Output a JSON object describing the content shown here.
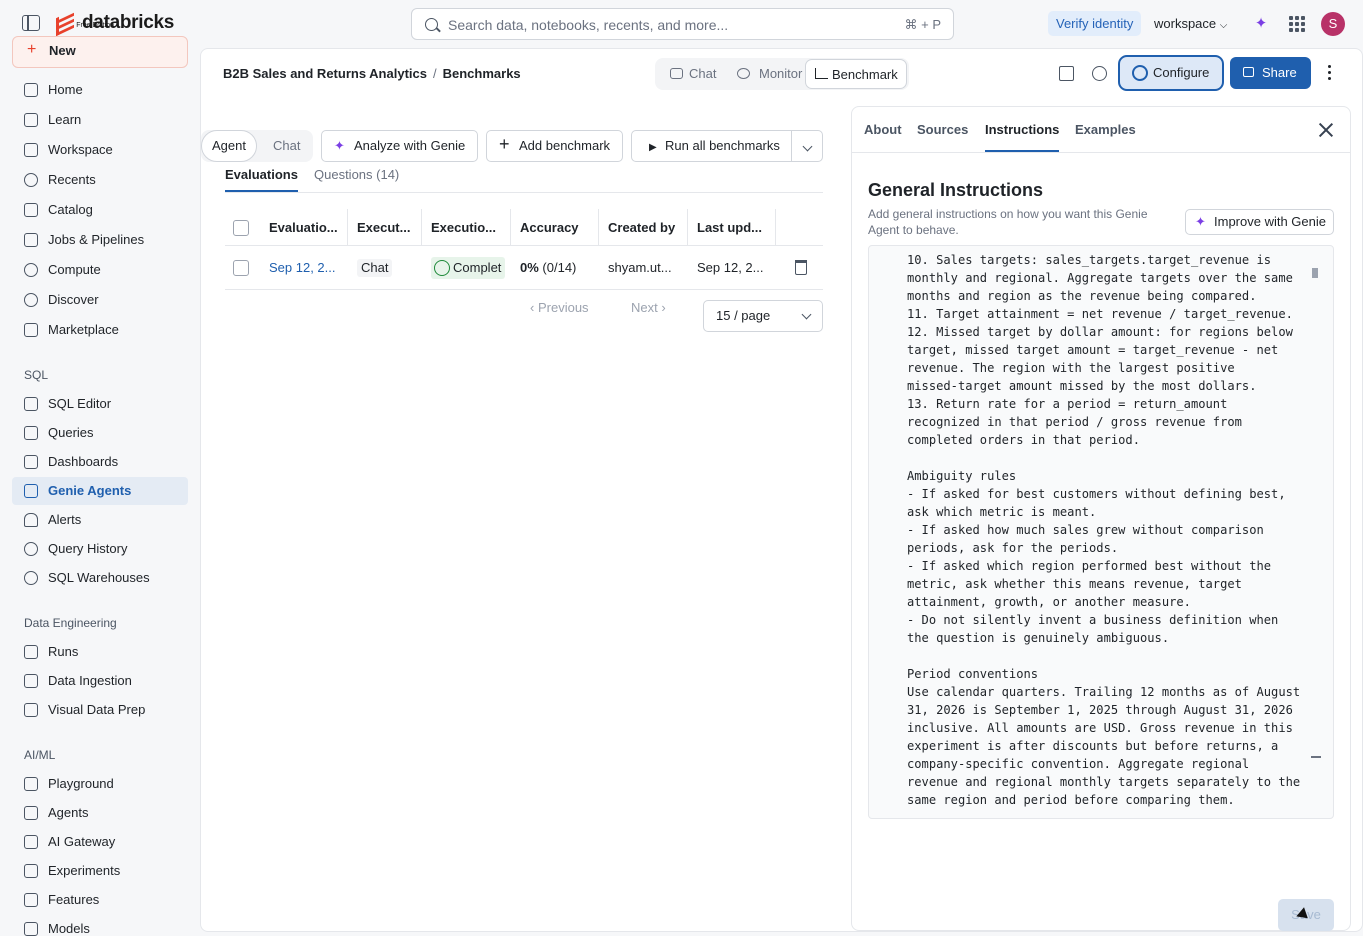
{
  "topbar": {
    "logo_name": "databricks",
    "logo_sub": "Free Edition",
    "search_placeholder": "Search data, notebooks, recents, and more...",
    "search_shortcut": "⌘ + P",
    "verify_label": "Verify identity",
    "workspace_label": "workspace",
    "avatar_initial": "S"
  },
  "sidebar": {
    "new_label": "New",
    "items": [
      {
        "label": "Home"
      },
      {
        "label": "Learn"
      },
      {
        "label": "Workspace"
      },
      {
        "label": "Recents"
      },
      {
        "label": "Catalog"
      },
      {
        "label": "Jobs & Pipelines"
      },
      {
        "label": "Compute"
      },
      {
        "label": "Discover"
      },
      {
        "label": "Marketplace"
      }
    ],
    "sql_label": "SQL",
    "sql_items": [
      {
        "label": "SQL Editor"
      },
      {
        "label": "Queries"
      },
      {
        "label": "Dashboards"
      },
      {
        "label": "Genie Agents"
      },
      {
        "label": "Alerts"
      },
      {
        "label": "Query History"
      },
      {
        "label": "SQL Warehouses"
      }
    ],
    "de_label": "Data Engineering",
    "de_items": [
      {
        "label": "Runs"
      },
      {
        "label": "Data Ingestion"
      },
      {
        "label": "Visual Data Prep"
      }
    ],
    "ai_label": "AI/ML",
    "ai_items": [
      {
        "label": "Playground"
      },
      {
        "label": "Agents"
      },
      {
        "label": "AI Gateway"
      },
      {
        "label": "Experiments"
      },
      {
        "label": "Features"
      },
      {
        "label": "Models"
      }
    ]
  },
  "header": {
    "space_name": "B2B Sales and Returns Analytics",
    "separator": "/",
    "page": "Benchmarks",
    "tabs": [
      {
        "label": "Chat"
      },
      {
        "label": "Monitor"
      },
      {
        "label": "Benchmark"
      }
    ],
    "configure_label": "Configure",
    "share_label": "Share"
  },
  "bench": {
    "seg_agent": "Agent",
    "seg_chat": "Chat",
    "analyze_label": "Analyze with Genie",
    "add_label": "Add benchmark",
    "run_label": "Run all benchmarks",
    "subtab_eval": "Evaluations",
    "subtab_questions": "Questions (14)",
    "columns": [
      "Evaluatio...",
      "Execut...",
      "Executio...",
      "Accuracy",
      "Created by",
      "Last upd..."
    ],
    "row": {
      "evaluation": "Sep 12, 2...",
      "executor": "Chat",
      "status": "Complet",
      "accuracy_pct": "0%",
      "accuracy_frac": "(0/14)",
      "created_by": "shyam.ut...",
      "last_updated": "Sep 12, 2..."
    },
    "previous_label": "Previous",
    "next_label": "Next",
    "page_size": "15 / page"
  },
  "panel": {
    "tabs": [
      {
        "label": "About"
      },
      {
        "label": "Sources"
      },
      {
        "label": "Instructions"
      },
      {
        "label": "Examples"
      }
    ],
    "title": "General Instructions",
    "description": "Add general instructions on how you want this Genie Agent to behave.",
    "improve_label": "Improve with Genie",
    "instructions_text": "10. Sales targets: sales_targets.target_revenue is\nmonthly and regional. Aggregate targets over the same\nmonths and region as the revenue being compared.\n11. Target attainment = net revenue / target_revenue.\n12. Missed target by dollar amount: for regions below\ntarget, missed target amount = target_revenue - net\nrevenue. The region with the largest positive\nmissed-target amount missed by the most dollars.\n13. Return rate for a period = return_amount\nrecognized in that period / gross revenue from\ncompleted orders in that period.\n\nAmbiguity rules\n- If asked for best customers without defining best,\nask which metric is meant.\n- If asked how much sales grew without comparison\nperiods, ask for the periods.\n- If asked which region performed best without the\nmetric, ask whether this means revenue, target\nattainment, growth, or another measure.\n- Do not silently invent a business definition when\nthe question is genuinely ambiguous.\n\nPeriod conventions\nUse calendar quarters. Trailing 12 months as of August\n31, 2026 is September 1, 2025 through August 31, 2026\ninclusive. All amounts are USD. Gross revenue in this\nexperiment is after discounts but before returns, a\ncompany-specific convention. Aggregate regional\nrevenue and regional monthly targets separately to the\nsame region and period before comparing them.",
    "save_label": "Save"
  }
}
